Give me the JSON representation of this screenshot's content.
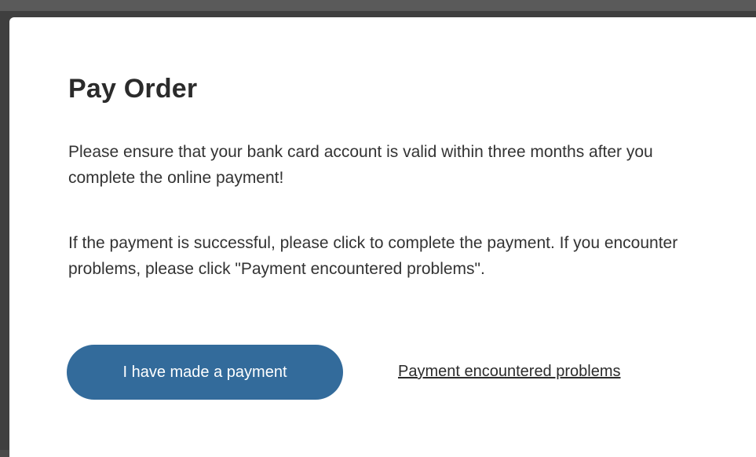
{
  "dialog": {
    "title": "Pay Order",
    "paragraph_1": "Please ensure that your bank card account is valid within three months after you complete the online payment!",
    "paragraph_2": "If the payment is successful, please click to complete the payment. If you encounter problems, please click \"Payment encountered problems\".",
    "confirm_button_label": "I have made a payment",
    "problem_link_label": "Payment encountered problems"
  },
  "colors": {
    "primary_button": "#336b9b",
    "text": "#333333",
    "overlay": "#3f3f3f"
  }
}
